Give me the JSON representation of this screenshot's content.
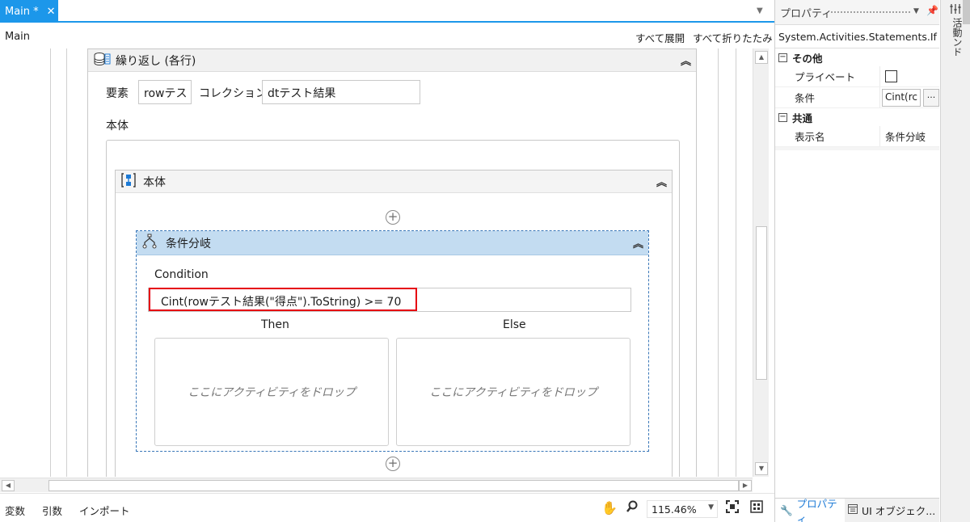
{
  "tab": {
    "label": "Main *",
    "close": "✕"
  },
  "breadcrumb": "Main",
  "toolbar": {
    "expand_all": "すべて展開",
    "collapse_all": "すべて折りたたみ"
  },
  "foreach": {
    "title": "繰り返し (各行)",
    "element_label": "要素",
    "element_value": "rowテスト",
    "collection_label": "コレクション",
    "collection_value": "dtテスト結果",
    "body_label": "本体"
  },
  "sequence": {
    "title": "本体"
  },
  "if_activity": {
    "title": "条件分岐",
    "condition_label": "Condition",
    "condition_value": "Cint(rowテスト結果(\"得点\").ToString) >= 70",
    "then_label": "Then",
    "else_label": "Else",
    "then_drop": "ここにアクティビティをドロップ",
    "else_drop": "ここにアクティビティをドロップ"
  },
  "status": {
    "variables": "変数",
    "arguments": "引数",
    "imports": "インポート",
    "zoom": "115.46%"
  },
  "properties": {
    "title": "プロパティ",
    "type": "System.Activities.Statements.If",
    "categories": [
      {
        "name": "その他",
        "rows": [
          {
            "name": "プライベート",
            "value": ""
          },
          {
            "name": "条件",
            "value": "Cint(rc"
          }
        ]
      },
      {
        "name": "共通",
        "rows": [
          {
            "name": "表示名",
            "value": "条件分岐"
          }
        ]
      }
    ],
    "tabs": {
      "properties": "プロパティ",
      "ui_objects": "UI オブジェク..."
    }
  },
  "dock": {
    "label": "活動",
    "label2": "ンド"
  },
  "colors": {
    "accent": "#1c97ea",
    "highlight": "#e60012",
    "if_header": "#c3dcf1"
  }
}
